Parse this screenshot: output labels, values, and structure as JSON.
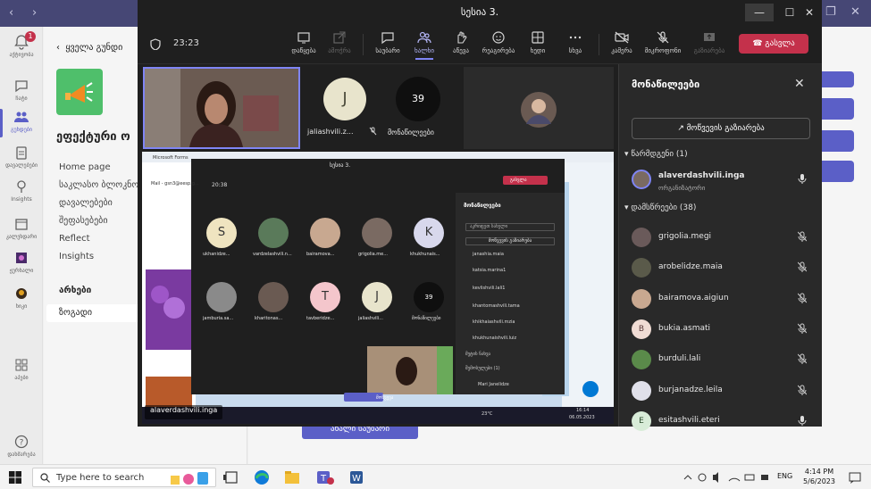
{
  "colors": {
    "teams_purple": "#5b5fc7",
    "teams_titlebar": "#464775",
    "leave_red": "#c4314b",
    "meeting_bg": "#1f1f1f",
    "panel_bg": "#292929",
    "active_tab": "#7f85f5"
  },
  "teams": {
    "rail": [
      {
        "label": "აქტივობა",
        "icon": "bell-icon",
        "badge": "1"
      },
      {
        "label": "ჩატი",
        "icon": "chat-icon"
      },
      {
        "label": "გუნდები",
        "icon": "teams-icon",
        "active": true
      },
      {
        "label": "დავალებები",
        "icon": "assignments-icon"
      },
      {
        "label": "Insights",
        "icon": "insights-icon"
      },
      {
        "label": "კალენდარი",
        "icon": "calendar-icon"
      },
      {
        "label": "ჟურნალი",
        "icon": "journal-icon"
      },
      {
        "label": "ნიკი",
        "icon": "app-icon"
      },
      {
        "label": "აპები",
        "icon": "apps-icon"
      },
      {
        "label": "დახმარება",
        "icon": "help-icon"
      }
    ],
    "back_label": "ყველა გუნდი",
    "team_name": "ეფექტური ო",
    "links": [
      "Home page",
      "საკლასო ბლოკნოტი",
      "დავალებები",
      "შეფასებები",
      "Reflect",
      "Insights"
    ],
    "channels_header": "არხები",
    "channel_general": "ზოგადი",
    "new_conversation": "ახალი საუბარი"
  },
  "meeting": {
    "title": "სესია 3.",
    "timer": "23:23",
    "toolbar": [
      {
        "label": "დაწყება",
        "icon": "view-icon"
      },
      {
        "label": "ამოჭრა",
        "icon": "popout-icon",
        "disabled": true
      },
      {
        "label": "საუბარი",
        "icon": "chat-icon"
      },
      {
        "label": "ხალხი",
        "icon": "people-icon",
        "active": true
      },
      {
        "label": "აწევა",
        "icon": "hand-icon"
      },
      {
        "label": "რეაგირება",
        "icon": "smile-icon"
      },
      {
        "label": "ხედი",
        "icon": "grid-icon"
      },
      {
        "label": "სხვა",
        "icon": "more-icon"
      },
      {
        "label": "კამერა",
        "icon": "camera-off-icon"
      },
      {
        "label": "მიკროფონი",
        "icon": "mic-off-icon"
      },
      {
        "label": "გაზიარება",
        "icon": "share-icon",
        "disabled": true
      }
    ],
    "leave_label": "გასვლა",
    "tiles": {
      "j_initial": "J",
      "j_name": "jaliashvili.z...",
      "count": "39",
      "count_label": "მონაწილეები"
    },
    "shared_screen": {
      "presenter": "alaverdashvili.inga",
      "inner_title": "სესია 3.",
      "inner_timer": "20:38",
      "inner_panel_title": "მონაწილეები",
      "inner_invite": "მოწვევის გაზიარება",
      "inner_search": "აკრიფეთ სახელი",
      "inner_leave": "გასვლა",
      "inner_people": [
        "janashia.maia",
        "katsia.marina1",
        "kevlishvili.lali1",
        "khantomashvili.tama",
        "khikhaiashvili.mzia",
        "khukhunaishvili.luiz"
      ],
      "inner_section": "მეტის ნახვა",
      "inner_section2": "შემოსულები (1)",
      "inner_attendee": "Mari Janelidze",
      "inner_tiles": [
        {
          "initial": "S",
          "name": "ukhanidze..."
        },
        {
          "initial": "",
          "name": "vardzelashvili.n..."
        },
        {
          "initial": "",
          "name": "bairamova..."
        },
        {
          "initial": "",
          "name": "grigolia.me..."
        },
        {
          "initial": "K",
          "name": "khukhunais..."
        },
        {
          "initial": "",
          "name": "jamburia.sa..."
        },
        {
          "initial": "",
          "name": "kharitonas..."
        },
        {
          "initial": "T",
          "name": "tavberidze..."
        },
        {
          "initial": "J",
          "name": "jaliashvili..."
        },
        {
          "initial": "39",
          "name": "მონაწილეები"
        }
      ],
      "inner_time": "16:14",
      "inner_date": "06.05.2023",
      "inner_temp": "23°C",
      "inner_btn": "მოწვევა",
      "inner_mail": "Mail - gsn3@eesp.g...",
      "inner_ms": "Microsoft Forms"
    },
    "participants": {
      "title": "მონაწილეები",
      "invite": "მოწვევის გაზიარება",
      "organizers_header": "წარმდგენი (1)",
      "organizer": {
        "name": "alaverdashvili.inga",
        "role": "ორგანიზატორი"
      },
      "attendees_header": "დამსწრეები (38)",
      "attendees": [
        {
          "name": "grigolia.megi",
          "initial": ""
        },
        {
          "name": "arobelidze.maia",
          "initial": ""
        },
        {
          "name": "bairamova.aigiun",
          "initial": ""
        },
        {
          "name": "bukia.asmati",
          "initial": "B"
        },
        {
          "name": "burduli.lali",
          "initial": ""
        },
        {
          "name": "burjanadze.leila",
          "initial": ""
        },
        {
          "name": "esitashvili.eteri",
          "initial": "E"
        }
      ]
    }
  },
  "taskbar": {
    "search_placeholder": "Type here to search",
    "lang": "ENG",
    "time": "4:14 PM",
    "date": "5/6/2023"
  }
}
